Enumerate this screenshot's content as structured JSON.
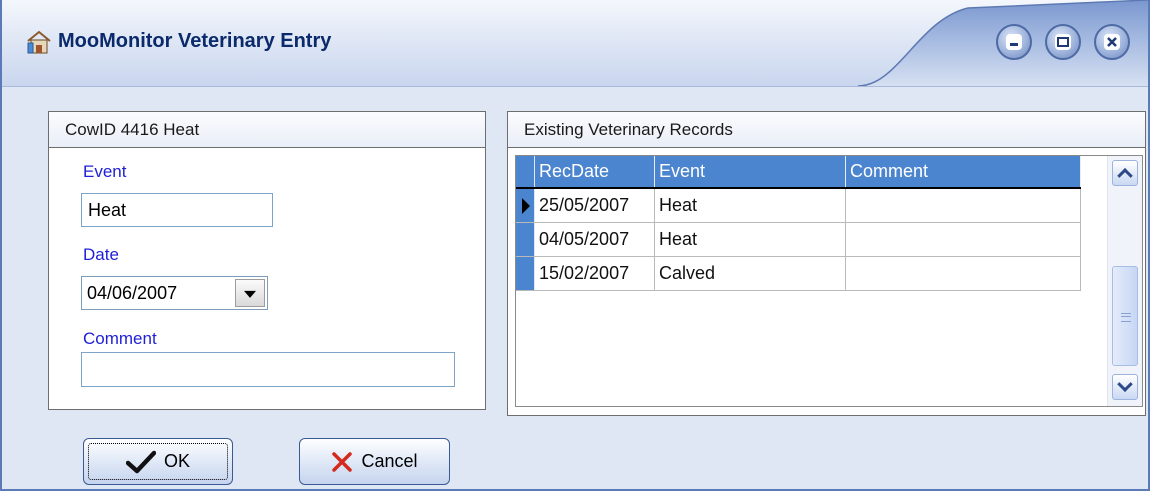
{
  "window": {
    "title": "MooMonitor Veterinary Entry",
    "icon": "barn-icon",
    "controls": [
      "minimize-icon",
      "maximize-icon",
      "close-icon"
    ],
    "accent_color": "#4b84cf",
    "label_color": "#1f1fd6"
  },
  "entry_panel": {
    "header": "CowID 4416 Heat",
    "event_label": "Event",
    "event_value": "Heat",
    "date_label": "Date",
    "date_value": "04/06/2007",
    "comment_label": "Comment",
    "comment_value": ""
  },
  "records_panel": {
    "header": "Existing Veterinary Records",
    "columns": [
      "RecDate",
      "Event",
      "Comment"
    ],
    "rows": [
      {
        "recdate": "25/05/2007",
        "event": "Heat",
        "comment": "",
        "current": true
      },
      {
        "recdate": "04/05/2007",
        "event": "Heat",
        "comment": "",
        "current": false
      },
      {
        "recdate": "15/02/2007",
        "event": "Calved",
        "comment": "",
        "current": false
      }
    ]
  },
  "buttons": {
    "ok_label": "OK",
    "ok_icon": "checkmark-icon",
    "cancel_label": "Cancel",
    "cancel_icon": "x-icon"
  }
}
